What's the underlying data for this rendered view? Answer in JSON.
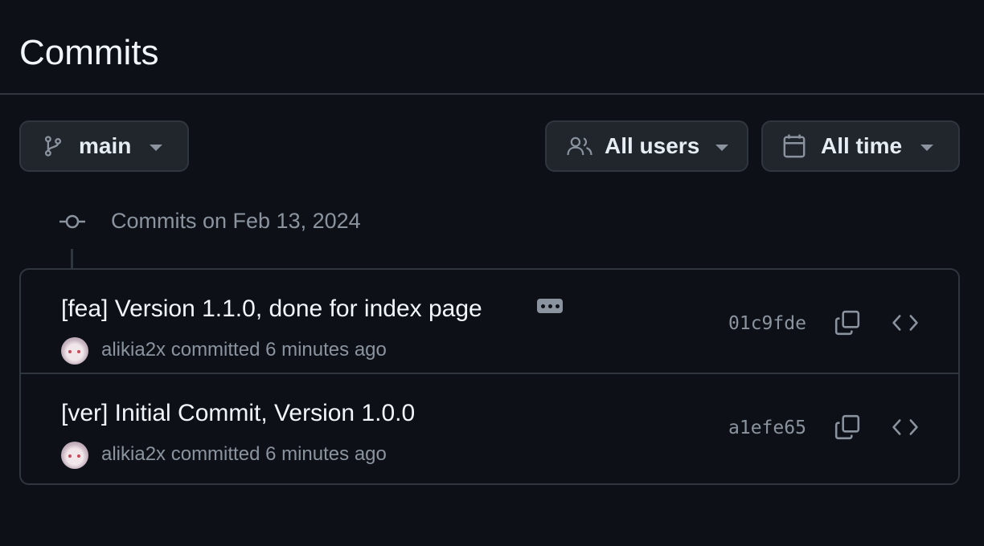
{
  "header": {
    "title": "Commits"
  },
  "filters": {
    "branch": {
      "label": "main",
      "icon": "git-branch-icon"
    },
    "users": {
      "label": "All users",
      "icon": "people-icon"
    },
    "time": {
      "label": "All time",
      "icon": "calendar-icon"
    }
  },
  "timeline": {
    "date_heading": "Commits on Feb 13, 2024"
  },
  "commits": [
    {
      "title": "[fea] Version 1.1.0, done for index page",
      "has_ellipsis": true,
      "author": "alikia2x",
      "action": "committed",
      "time": "6 minutes ago",
      "sha": "01c9fde"
    },
    {
      "title": "[ver] Initial Commit, Version 1.0.0",
      "has_ellipsis": false,
      "author": "alikia2x",
      "action": "committed",
      "time": "6 minutes ago",
      "sha": "a1efe65"
    }
  ],
  "colors": {
    "background": "#0d1117",
    "border": "#30363d",
    "button_bg": "#21262d",
    "muted_text": "#8b949e",
    "primary_text": "#f0f6fc"
  }
}
